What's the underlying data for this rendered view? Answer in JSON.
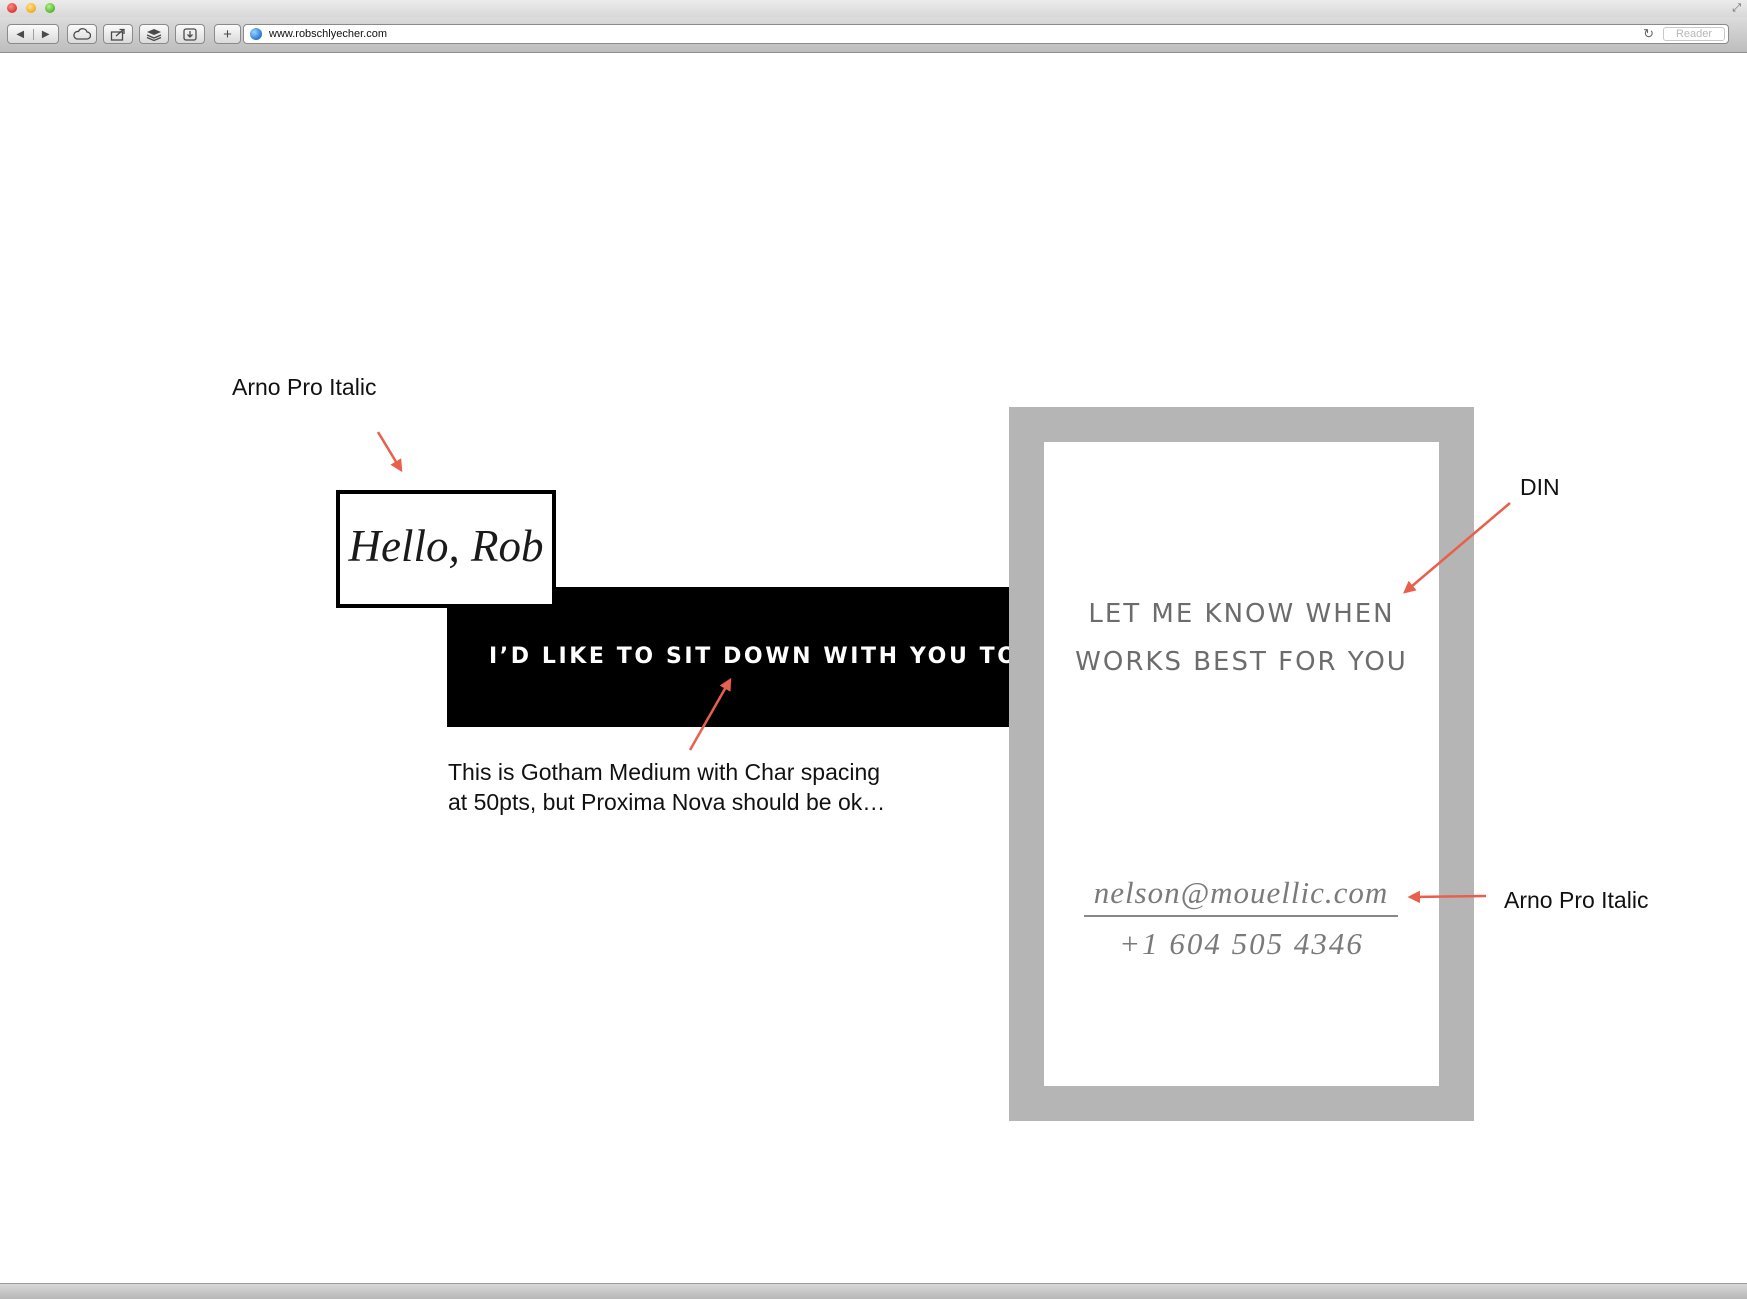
{
  "browser": {
    "url": "www.robschlyecher.com",
    "reader_label": "Reader",
    "icons": {
      "back": "back-arrow-icon",
      "forward": "forward-arrow-icon",
      "cloud": "cloud-icon",
      "share": "share-icon",
      "layers": "layers-icon",
      "download": "download-icon",
      "new_tab": "plus-icon",
      "globe": "globe-icon",
      "reload": "reload-icon",
      "fullscreen": "fullscreen-icon"
    }
  },
  "mockup": {
    "hello_text": "Hello, Rob",
    "banner_text": "I’D LIKE TO SIT DOWN WITH YOU TO S",
    "card": {
      "heading_line1": "LET ME KNOW WHEN",
      "heading_line2": "WORKS BEST FOR YOU",
      "email": "nelson@mouellic.com",
      "phone": "+1 604 505 4346"
    }
  },
  "annotations": {
    "font_note_hello": "Arno Pro Italic",
    "font_note_heading": "DIN",
    "font_note_contact": "Arno Pro Italic",
    "font_note_banner_line1": "This is Gotham Medium with Char spacing",
    "font_note_banner_line2": "at 50pts, but Proxima Nova should be ok…"
  },
  "colors": {
    "arrow": "#e8604c",
    "card_frame": "#b5b5b5",
    "band": "#000000"
  }
}
